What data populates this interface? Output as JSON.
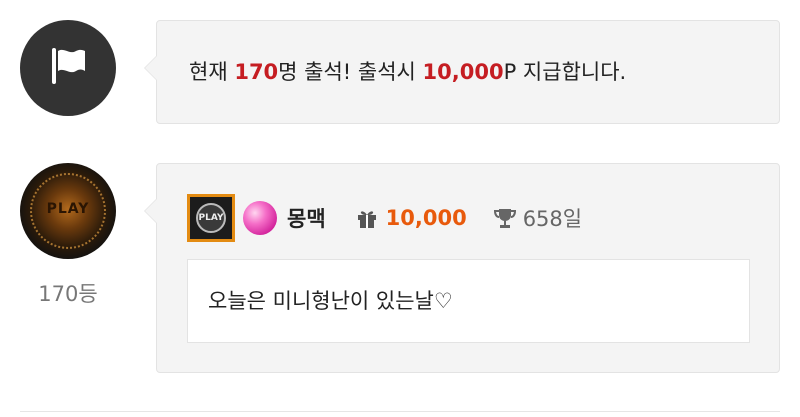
{
  "notice": {
    "icon": "flag-icon",
    "prefix": "현재 ",
    "count": "170",
    "middle": "명 출석! 출석시 ",
    "points": "10,000",
    "suffix": "P 지급합니다."
  },
  "comment": {
    "avatar_label": "PLAY",
    "rank": "170등",
    "level_badge_label": "PLAY",
    "nickname": "몽맥",
    "points": "10,000",
    "days": "658일",
    "message": "오늘은 미니형난이 있는날♡"
  },
  "colors": {
    "highlight": "#c51d22",
    "points": "#e85a0c",
    "bubble_bg": "#f4f4f4"
  }
}
